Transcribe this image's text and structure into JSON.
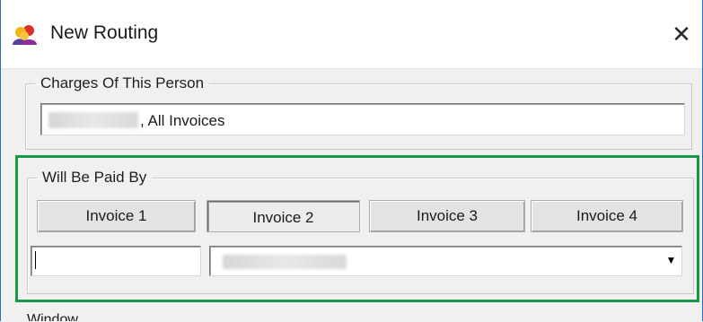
{
  "window": {
    "title": "New Routing",
    "icon": "people-group-icon",
    "close_glyph": "✕"
  },
  "charges_group": {
    "legend": "Charges Of This Person",
    "value_suffix": ", All Invoices"
  },
  "paid_by_group": {
    "legend": "Will Be Paid By",
    "buttons": [
      {
        "label": "Invoice 1",
        "pressed": false
      },
      {
        "label": "Invoice 2",
        "pressed": true
      },
      {
        "label": "Invoice 3",
        "pressed": false
      },
      {
        "label": "Invoice 4",
        "pressed": false
      }
    ],
    "room_input_value": "",
    "dropdown_arrow": "▼"
  },
  "colors": {
    "highlight": "#16974a",
    "window_border": "#2e6fbd",
    "dialog_bg": "#f0f0f0"
  },
  "next_group_partial_label": "Window"
}
